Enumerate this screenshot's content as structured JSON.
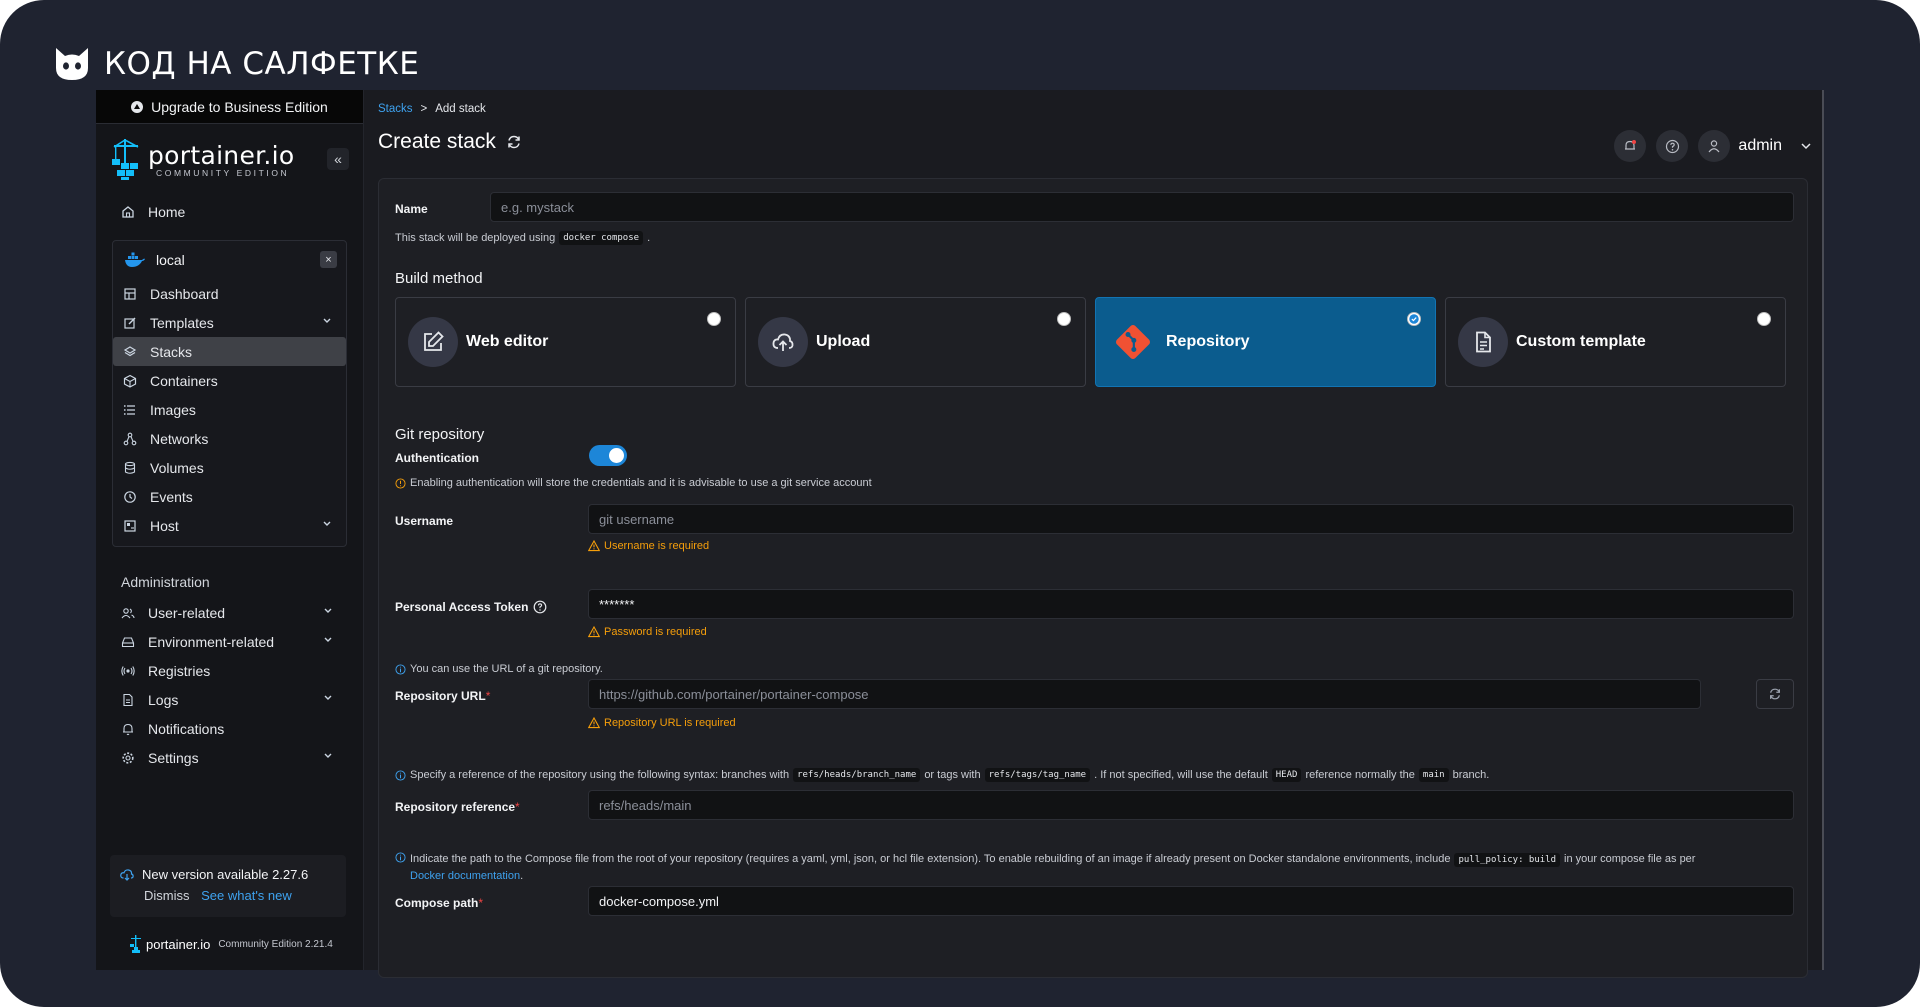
{
  "brand": {
    "text": "КОД НА САЛФЕТКЕ"
  },
  "sidebar": {
    "upgrade_label": "Upgrade to Business Edition",
    "logo_main": "portainer.io",
    "logo_sub": "COMMUNITY EDITION",
    "collapse_label": "«",
    "home_label": "Home",
    "environment": {
      "name": "local",
      "close_label": "×",
      "items": [
        {
          "label": "Dashboard",
          "icon": "dashboard-icon"
        },
        {
          "label": "Templates",
          "icon": "edit-icon",
          "expandable": true
        },
        {
          "label": "Stacks",
          "icon": "layers-icon",
          "active": true
        },
        {
          "label": "Containers",
          "icon": "box-icon"
        },
        {
          "label": "Images",
          "icon": "list-icon"
        },
        {
          "label": "Networks",
          "icon": "network-icon"
        },
        {
          "label": "Volumes",
          "icon": "database-icon"
        },
        {
          "label": "Events",
          "icon": "clock-icon"
        },
        {
          "label": "Host",
          "icon": "host-icon",
          "expandable": true
        }
      ]
    },
    "admin_title": "Administration",
    "admin_items": [
      {
        "label": "User-related",
        "icon": "users-icon",
        "expandable": true
      },
      {
        "label": "Environment-related",
        "icon": "drive-icon",
        "expandable": true
      },
      {
        "label": "Registries",
        "icon": "radio-icon"
      },
      {
        "label": "Logs",
        "icon": "file-icon",
        "expandable": true
      },
      {
        "label": "Notifications",
        "icon": "bell-icon"
      },
      {
        "label": "Settings",
        "icon": "gear-icon",
        "expandable": true
      }
    ],
    "update": {
      "message": "New version available 2.27.6",
      "dismiss": "Dismiss",
      "whats_new": "See what's new"
    },
    "footer_logo": "portainer.io",
    "footer_version": "Community Edition 2.21.4"
  },
  "header": {
    "breadcrumb_root": "Stacks",
    "breadcrumb_sep": ">",
    "breadcrumb_current": "Add stack",
    "title": "Create stack",
    "user": "admin"
  },
  "form": {
    "name_label": "Name",
    "name_placeholder": "e.g. mystack",
    "deploy_hint_pre": "This stack will be deployed using",
    "deploy_hint_code": "docker compose",
    "deploy_hint_post": ".",
    "build_method_title": "Build method",
    "methods": [
      {
        "label": "Web editor",
        "icon": "edit-icon",
        "selected": false
      },
      {
        "label": "Upload",
        "icon": "upload-cloud-icon",
        "selected": false
      },
      {
        "label": "Repository",
        "icon": "git-icon",
        "selected": true
      },
      {
        "label": "Custom template",
        "icon": "file-text-icon",
        "selected": false
      }
    ],
    "git_title": "Git repository",
    "auth_label": "Authentication",
    "auth_enabled": true,
    "auth_hint": "Enabling authentication will store the credentials and it is advisable to use a git service account",
    "username_label": "Username",
    "username_placeholder": "git username",
    "username_error": "Username is required",
    "token_label": "Personal Access Token",
    "token_value": "*******",
    "token_error": "Password is required",
    "url_hint": "You can use the URL of a git repository.",
    "url_label": "Repository URL",
    "url_placeholder": "https://github.com/portainer/portainer-compose",
    "url_error": "Repository URL is required",
    "ref_hint_1": "Specify a reference of the repository using the following syntax: branches with",
    "ref_hint_code1": "refs/heads/branch_name",
    "ref_hint_2": "or tags with",
    "ref_hint_code2": "refs/tags/tag_name",
    "ref_hint_3": ". If not specified, will use the default",
    "ref_hint_code3": "HEAD",
    "ref_hint_4": "reference normally the",
    "ref_hint_code4": "main",
    "ref_hint_5": "branch.",
    "ref_label": "Repository reference",
    "ref_placeholder": "refs/heads/main",
    "path_hint_1": "Indicate the path to the Compose file from the root of your repository (requires a yaml, yml, json, or hcl file extension).  To enable rebuilding of an image if already present on Docker standalone environments, include",
    "path_hint_code": "pull_policy: build",
    "path_hint_2": "in your compose file as per",
    "path_hint_link": "Docker documentation",
    "path_hint_3": ".",
    "path_label": "Compose path",
    "path_value": "docker-compose.yml"
  },
  "colors": {
    "accent": "#1d86d8",
    "selected_card": "#0b5c8e",
    "warning": "#f59e0b",
    "link": "#3ea2ef"
  }
}
